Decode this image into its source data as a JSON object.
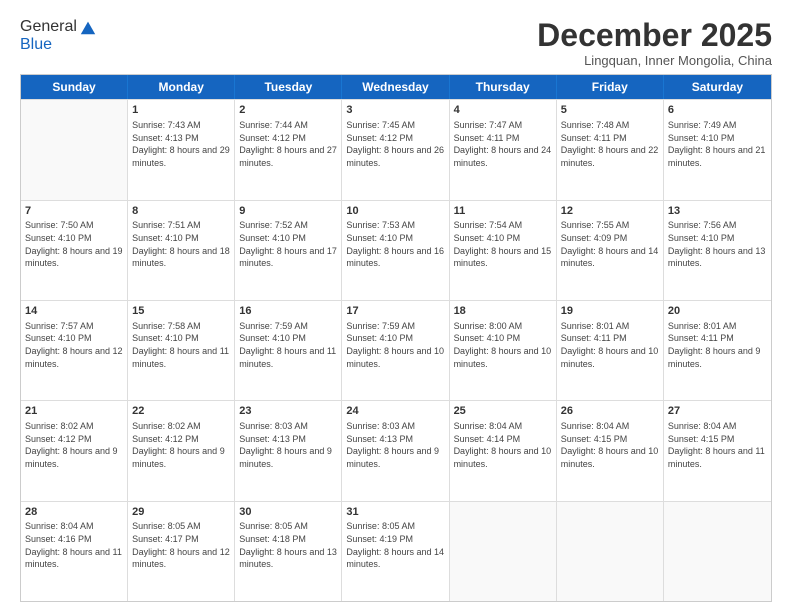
{
  "logo": {
    "general": "General",
    "blue": "Blue"
  },
  "header": {
    "month": "December 2025",
    "location": "Lingquan, Inner Mongolia, China"
  },
  "weekdays": [
    "Sunday",
    "Monday",
    "Tuesday",
    "Wednesday",
    "Thursday",
    "Friday",
    "Saturday"
  ],
  "rows": [
    [
      {
        "day": "",
        "empty": true
      },
      {
        "day": "1",
        "rise": "Sunrise: 7:43 AM",
        "set": "Sunset: 4:13 PM",
        "daylight": "Daylight: 8 hours and 29 minutes."
      },
      {
        "day": "2",
        "rise": "Sunrise: 7:44 AM",
        "set": "Sunset: 4:12 PM",
        "daylight": "Daylight: 8 hours and 27 minutes."
      },
      {
        "day": "3",
        "rise": "Sunrise: 7:45 AM",
        "set": "Sunset: 4:12 PM",
        "daylight": "Daylight: 8 hours and 26 minutes."
      },
      {
        "day": "4",
        "rise": "Sunrise: 7:47 AM",
        "set": "Sunset: 4:11 PM",
        "daylight": "Daylight: 8 hours and 24 minutes."
      },
      {
        "day": "5",
        "rise": "Sunrise: 7:48 AM",
        "set": "Sunset: 4:11 PM",
        "daylight": "Daylight: 8 hours and 22 minutes."
      },
      {
        "day": "6",
        "rise": "Sunrise: 7:49 AM",
        "set": "Sunset: 4:10 PM",
        "daylight": "Daylight: 8 hours and 21 minutes."
      }
    ],
    [
      {
        "day": "7",
        "rise": "Sunrise: 7:50 AM",
        "set": "Sunset: 4:10 PM",
        "daylight": "Daylight: 8 hours and 19 minutes."
      },
      {
        "day": "8",
        "rise": "Sunrise: 7:51 AM",
        "set": "Sunset: 4:10 PM",
        "daylight": "Daylight: 8 hours and 18 minutes."
      },
      {
        "day": "9",
        "rise": "Sunrise: 7:52 AM",
        "set": "Sunset: 4:10 PM",
        "daylight": "Daylight: 8 hours and 17 minutes."
      },
      {
        "day": "10",
        "rise": "Sunrise: 7:53 AM",
        "set": "Sunset: 4:10 PM",
        "daylight": "Daylight: 8 hours and 16 minutes."
      },
      {
        "day": "11",
        "rise": "Sunrise: 7:54 AM",
        "set": "Sunset: 4:10 PM",
        "daylight": "Daylight: 8 hours and 15 minutes."
      },
      {
        "day": "12",
        "rise": "Sunrise: 7:55 AM",
        "set": "Sunset: 4:09 PM",
        "daylight": "Daylight: 8 hours and 14 minutes."
      },
      {
        "day": "13",
        "rise": "Sunrise: 7:56 AM",
        "set": "Sunset: 4:10 PM",
        "daylight": "Daylight: 8 hours and 13 minutes."
      }
    ],
    [
      {
        "day": "14",
        "rise": "Sunrise: 7:57 AM",
        "set": "Sunset: 4:10 PM",
        "daylight": "Daylight: 8 hours and 12 minutes."
      },
      {
        "day": "15",
        "rise": "Sunrise: 7:58 AM",
        "set": "Sunset: 4:10 PM",
        "daylight": "Daylight: 8 hours and 11 minutes."
      },
      {
        "day": "16",
        "rise": "Sunrise: 7:59 AM",
        "set": "Sunset: 4:10 PM",
        "daylight": "Daylight: 8 hours and 11 minutes."
      },
      {
        "day": "17",
        "rise": "Sunrise: 7:59 AM",
        "set": "Sunset: 4:10 PM",
        "daylight": "Daylight: 8 hours and 10 minutes."
      },
      {
        "day": "18",
        "rise": "Sunrise: 8:00 AM",
        "set": "Sunset: 4:10 PM",
        "daylight": "Daylight: 8 hours and 10 minutes."
      },
      {
        "day": "19",
        "rise": "Sunrise: 8:01 AM",
        "set": "Sunset: 4:11 PM",
        "daylight": "Daylight: 8 hours and 10 minutes."
      },
      {
        "day": "20",
        "rise": "Sunrise: 8:01 AM",
        "set": "Sunset: 4:11 PM",
        "daylight": "Daylight: 8 hours and 9 minutes."
      }
    ],
    [
      {
        "day": "21",
        "rise": "Sunrise: 8:02 AM",
        "set": "Sunset: 4:12 PM",
        "daylight": "Daylight: 8 hours and 9 minutes."
      },
      {
        "day": "22",
        "rise": "Sunrise: 8:02 AM",
        "set": "Sunset: 4:12 PM",
        "daylight": "Daylight: 8 hours and 9 minutes."
      },
      {
        "day": "23",
        "rise": "Sunrise: 8:03 AM",
        "set": "Sunset: 4:13 PM",
        "daylight": "Daylight: 8 hours and 9 minutes."
      },
      {
        "day": "24",
        "rise": "Sunrise: 8:03 AM",
        "set": "Sunset: 4:13 PM",
        "daylight": "Daylight: 8 hours and 9 minutes."
      },
      {
        "day": "25",
        "rise": "Sunrise: 8:04 AM",
        "set": "Sunset: 4:14 PM",
        "daylight": "Daylight: 8 hours and 10 minutes."
      },
      {
        "day": "26",
        "rise": "Sunrise: 8:04 AM",
        "set": "Sunset: 4:15 PM",
        "daylight": "Daylight: 8 hours and 10 minutes."
      },
      {
        "day": "27",
        "rise": "Sunrise: 8:04 AM",
        "set": "Sunset: 4:15 PM",
        "daylight": "Daylight: 8 hours and 11 minutes."
      }
    ],
    [
      {
        "day": "28",
        "rise": "Sunrise: 8:04 AM",
        "set": "Sunset: 4:16 PM",
        "daylight": "Daylight: 8 hours and 11 minutes."
      },
      {
        "day": "29",
        "rise": "Sunrise: 8:05 AM",
        "set": "Sunset: 4:17 PM",
        "daylight": "Daylight: 8 hours and 12 minutes."
      },
      {
        "day": "30",
        "rise": "Sunrise: 8:05 AM",
        "set": "Sunset: 4:18 PM",
        "daylight": "Daylight: 8 hours and 13 minutes."
      },
      {
        "day": "31",
        "rise": "Sunrise: 8:05 AM",
        "set": "Sunset: 4:19 PM",
        "daylight": "Daylight: 8 hours and 14 minutes."
      },
      {
        "day": "",
        "empty": true
      },
      {
        "day": "",
        "empty": true
      },
      {
        "day": "",
        "empty": true
      }
    ]
  ]
}
